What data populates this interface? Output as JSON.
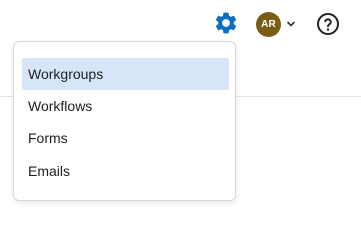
{
  "colors": {
    "accent": "#0a6fc2",
    "avatar_bg": "#7a5d14",
    "highlight": "#d6e6f8",
    "text": "#1e1e1e"
  },
  "header": {
    "settings_icon": "gear-icon",
    "avatar_initials": "AR",
    "avatar_menu_icon": "chevron-down-icon",
    "help_icon": "question-circle-icon"
  },
  "menu": {
    "items": [
      {
        "label": "Workgroups",
        "selected": true
      },
      {
        "label": "Workflows",
        "selected": false
      },
      {
        "label": "Forms",
        "selected": false
      },
      {
        "label": "Emails",
        "selected": false
      }
    ]
  }
}
